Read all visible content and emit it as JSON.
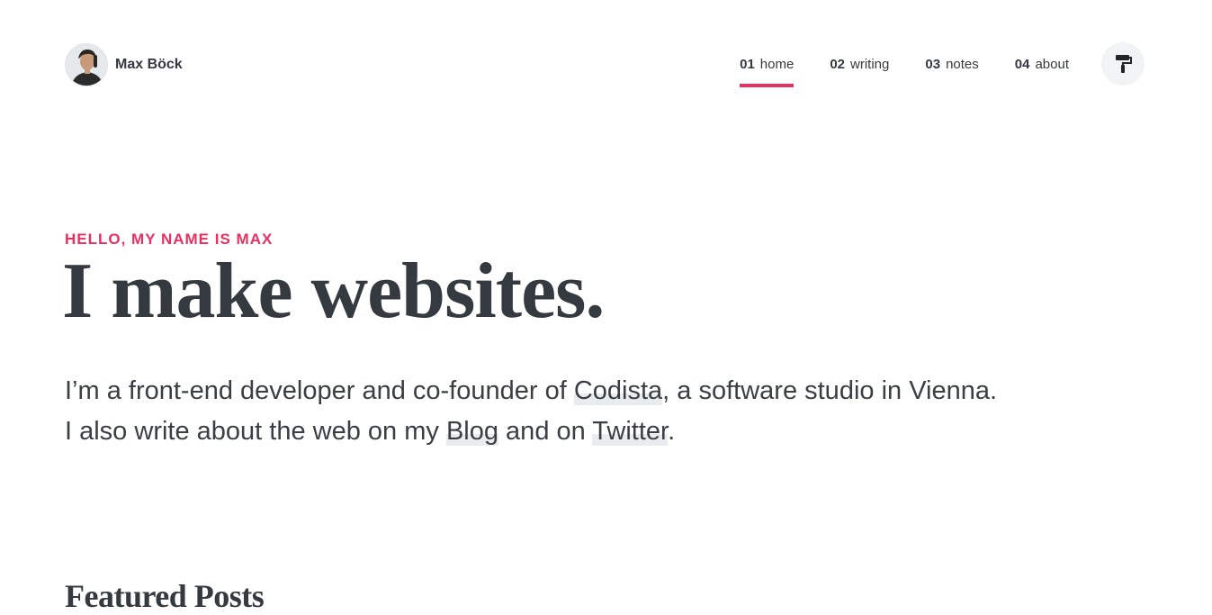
{
  "header": {
    "brand_name": "Max Böck",
    "nav": [
      {
        "num": "01",
        "label": "home"
      },
      {
        "num": "02",
        "label": "writing"
      },
      {
        "num": "03",
        "label": "notes"
      },
      {
        "num": "04",
        "label": "about"
      }
    ],
    "active_nav": "home"
  },
  "intro": {
    "kicker": "Hello, my name is Max",
    "headline": "I make websites.",
    "line1_pre": "I’m a front-end developer and co-founder of ",
    "line1_link": "Codista",
    "line1_post": ", a software studio in Vienna.",
    "line2_pre": "I also write about the web on my ",
    "line2_link1": "Blog",
    "line2_mid": " and on ",
    "line2_link2": "Twitter",
    "line2_post": "."
  },
  "featured": {
    "title": "Featured Posts"
  },
  "colors": {
    "accent": "#e83061",
    "text": "#343a40",
    "link_highlight": "#e9ecef"
  },
  "icons": {
    "theme_switcher": "paint-roller-icon"
  }
}
